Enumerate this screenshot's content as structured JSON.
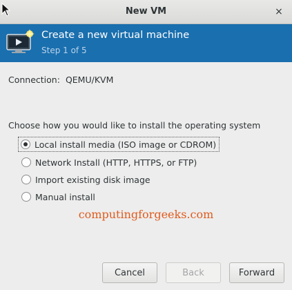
{
  "window": {
    "title": "New VM",
    "close_icon": "×"
  },
  "banner": {
    "title": "Create a new virtual machine",
    "step": "Step 1 of 5",
    "icon": "new-vm-icon",
    "background": "#1a6fae"
  },
  "connection": {
    "label": "Connection:",
    "value": "QEMU/KVM"
  },
  "install": {
    "prompt": "Choose how you would like to install the operating system",
    "options": [
      {
        "label": "Local install media (ISO image or CDROM)",
        "selected": true
      },
      {
        "label": "Network Install (HTTP, HTTPS, or FTP)",
        "selected": false
      },
      {
        "label": "Import existing disk image",
        "selected": false
      },
      {
        "label": "Manual install",
        "selected": false
      }
    ]
  },
  "watermark": "computingforgeeks.com",
  "buttons": {
    "cancel": "Cancel",
    "back": "Back",
    "forward": "Forward"
  }
}
